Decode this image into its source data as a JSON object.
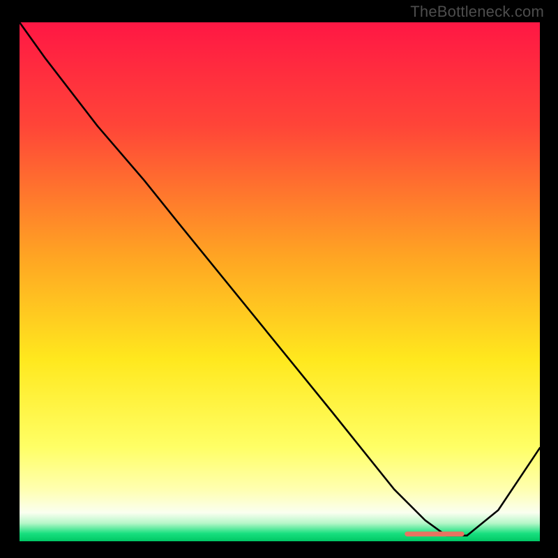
{
  "watermark": "TheBottleneck.com",
  "chart_data": {
    "type": "line",
    "title": "",
    "xlabel": "",
    "ylabel": "",
    "xlim": [
      0,
      100
    ],
    "ylim": [
      0,
      100
    ],
    "grid": false,
    "gradient_stops": [
      {
        "offset": 0.0,
        "color": "#ff1744"
      },
      {
        "offset": 0.2,
        "color": "#ff4538"
      },
      {
        "offset": 0.45,
        "color": "#ffa423"
      },
      {
        "offset": 0.65,
        "color": "#ffe81e"
      },
      {
        "offset": 0.82,
        "color": "#ffff66"
      },
      {
        "offset": 0.9,
        "color": "#ffffb0"
      },
      {
        "offset": 0.945,
        "color": "#fafff0"
      },
      {
        "offset": 0.965,
        "color": "#b7f7c9"
      },
      {
        "offset": 0.985,
        "color": "#18e07f"
      },
      {
        "offset": 1.0,
        "color": "#00c764"
      }
    ],
    "series": [
      {
        "name": "bottleneck-curve",
        "x": [
          0.0,
          5.0,
          15.0,
          24.0,
          30.0,
          45.0,
          60.0,
          72.0,
          78.0,
          82.0,
          86.0,
          92.0,
          100.0
        ],
        "y": [
          100.0,
          93.0,
          80.0,
          69.5,
          62.0,
          43.5,
          25.0,
          10.0,
          4.0,
          1.1,
          1.1,
          6.0,
          18.0
        ]
      }
    ],
    "marker": {
      "name": "highlight-segment",
      "x_start": 74.5,
      "x_end": 85.0,
      "y": 1.4,
      "color": "#e87361",
      "thickness": 1.2
    }
  }
}
